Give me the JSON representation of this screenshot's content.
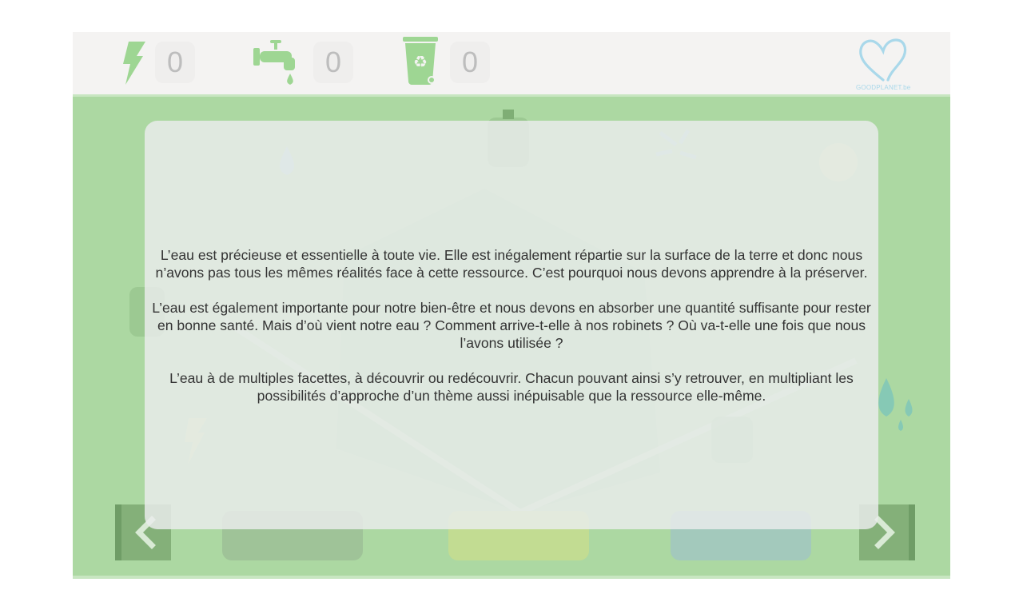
{
  "counters": [
    {
      "name": "energy",
      "icon": "lightning-bolt-icon",
      "value": "0"
    },
    {
      "name": "water",
      "icon": "water-faucet-icon",
      "value": "0"
    },
    {
      "name": "waste",
      "icon": "recycling-bin-icon",
      "value": "0"
    }
  ],
  "logo": {
    "icon": "heart-logo-icon",
    "text": "GOODPLANET.be"
  },
  "intro": {
    "paragraphs": [
      "L’eau est précieuse et essentielle à toute vie. Elle est inégalement répartie sur la surface de la terre et donc nous n’avons pas tous les mêmes réalités face à cette ressource. C’est pourquoi nous devons apprendre à la préserver.",
      "L’eau est également importante pour notre bien-être et nous devons en absorber une quantité suffisante pour rester en bonne santé. Mais d’où vient notre eau ? Comment arrive-t-elle à nos robinets ? Où va-t-elle une fois que nous l’avons utilisée ?",
      "L’eau à de multiples facettes, à découvrir ou redécouvrir. Chacun pouvant ainsi s’y retrouver, en multipliant les possibilités d’approche d’un thème aussi inépuisable que la ressource elle-même."
    ]
  },
  "navigation": {
    "prev_icon": "chevron-left-icon",
    "next_icon": "chevron-right-icon"
  },
  "colors": {
    "accent_green": "#9ed693",
    "game_background": "#acd8a2",
    "button_dark_green": "#9fc398",
    "button_yellow_green": "#c2dc92",
    "button_teal": "#a3c9bc",
    "logo_blue": "#a9d8ea"
  }
}
